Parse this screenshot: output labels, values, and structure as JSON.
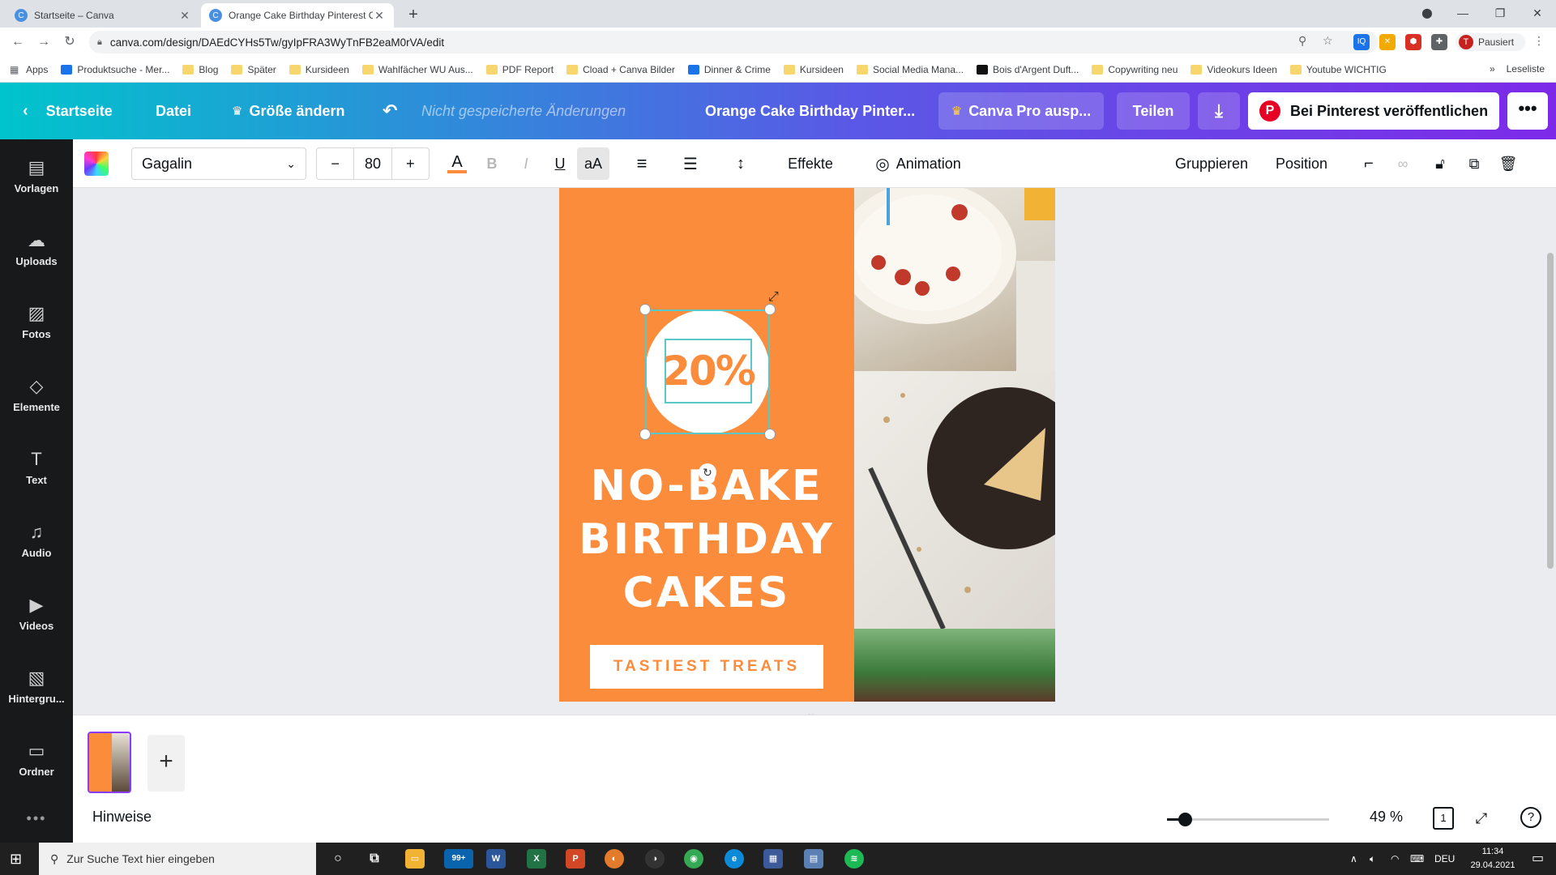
{
  "browser": {
    "tabs": [
      {
        "title": "Startseite – Canva",
        "favicon": "C"
      },
      {
        "title": "Orange Cake Birthday Pinterest C",
        "favicon": "C"
      }
    ],
    "url": "canva.com/design/DAEdCYHs5Tw/gyIpFRA3WyTnFB2eaM0rVA/edit",
    "profile_label": "Pausiert",
    "profile_initial": "T",
    "bookmarks": [
      "Apps",
      "Produktsuche - Mer...",
      "Blog",
      "Später",
      "Kursideen",
      "Wahlfächer WU Aus...",
      "PDF Report",
      "Cload + Canva Bilder",
      "Dinner & Crime",
      "Kursideen",
      "Social Media Mana...",
      "Bois d'Argent Duft...",
      "Copywriting neu",
      "Videokurs Ideen",
      "Youtube WICHTIG"
    ],
    "bookmarks_more": "»",
    "reading_list": "Leseliste"
  },
  "header": {
    "home": "Startseite",
    "file": "Datei",
    "resize": "Größe ändern",
    "unsaved": "Nicht gespeicherte Änderungen",
    "doc_title": "Orange Cake Birthday Pinter...",
    "canva_pro": "Canva Pro ausp...",
    "share": "Teilen",
    "publish": "Bei Pinterest veröffentlichen",
    "more": "•••"
  },
  "sidebar": {
    "items": [
      {
        "label": "Vorlagen",
        "icon": "templates-icon"
      },
      {
        "label": "Uploads",
        "icon": "upload-icon"
      },
      {
        "label": "Fotos",
        "icon": "photos-icon"
      },
      {
        "label": "Elemente",
        "icon": "elements-icon"
      },
      {
        "label": "Text",
        "icon": "text-icon"
      },
      {
        "label": "Audio",
        "icon": "audio-icon"
      },
      {
        "label": "Videos",
        "icon": "videos-icon"
      },
      {
        "label": "Hintergru...",
        "icon": "background-icon"
      },
      {
        "label": "Ordner",
        "icon": "folder-icon"
      }
    ],
    "more": "•••"
  },
  "toolbar": {
    "font": "Gagalin",
    "minus": "−",
    "size": "80",
    "plus": "+",
    "effects": "Effekte",
    "animation": "Animation",
    "group": "Gruppieren",
    "position": "Position"
  },
  "design": {
    "discount": "20%",
    "headline_line1": "NO-BAKE",
    "headline_line2": "BIRTHDAY",
    "headline_line3": "CAKES",
    "button": "TASTIEST TREATS"
  },
  "bottom": {
    "notes": "Hinweise",
    "zoom_pct": "49 %",
    "zoom_fraction": 0.11,
    "page_count": "1",
    "add_page": "+"
  },
  "taskbar": {
    "search_placeholder": "Zur Suche Text hier eingeben",
    "mail_badge": "99+",
    "lang": "DEU",
    "time": "11:34",
    "date": "29.04.2021"
  },
  "colors": {
    "orange": "#fb8c3c",
    "selection": "#5ac8c8",
    "purple": "#8b3dff",
    "pinterest": "#e60023"
  }
}
